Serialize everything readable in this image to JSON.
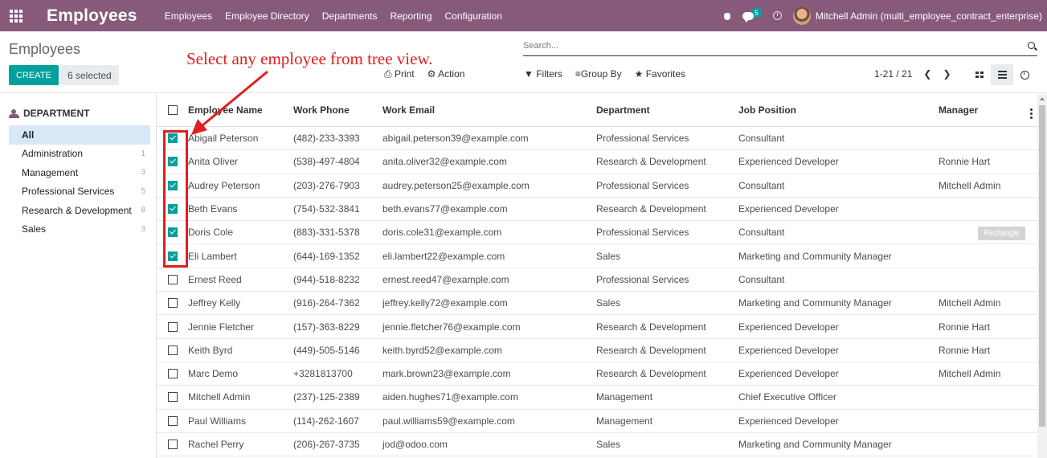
{
  "navbar": {
    "app_title": "Employees",
    "menu": [
      "Employees",
      "Employee Directory",
      "Departments",
      "Reporting",
      "Configuration"
    ],
    "chat_badge": "5",
    "user": "Mitchell Admin (multi_employee_contract_enterprise)"
  },
  "control_panel": {
    "breadcrumb": "Employees",
    "create_label": "CREATE",
    "selected_label": "6 selected",
    "search_placeholder": "Search...",
    "print_label": "Print",
    "action_label": "Action",
    "filters_label": "Filters",
    "group_by_label": "Group By",
    "favorites_label": "Favorites",
    "pager": "1-21 / 21"
  },
  "annotation": "Select any employee from tree view.",
  "sidebar": {
    "title": "DEPARTMENT",
    "items": [
      {
        "label": "All",
        "count": ""
      },
      {
        "label": "Administration",
        "count": "1"
      },
      {
        "label": "Management",
        "count": "3"
      },
      {
        "label": "Professional Services",
        "count": "5"
      },
      {
        "label": "Research & Development",
        "count": "8"
      },
      {
        "label": "Sales",
        "count": "3"
      }
    ]
  },
  "table": {
    "columns": [
      "Employee Name",
      "Work Phone",
      "Work Email",
      "Department",
      "Job Position",
      "Manager"
    ],
    "rows": [
      {
        "name": "Abigail Peterson",
        "phone": "(482)-233-3393",
        "email": "abigail.peterson39@example.com",
        "dept": "Professional Services",
        "job": "Consultant",
        "manager": "",
        "checked": true
      },
      {
        "name": "Anita Oliver",
        "phone": "(538)-497-4804",
        "email": "anita.oliver32@example.com",
        "dept": "Research & Development",
        "job": "Experienced Developer",
        "manager": "Ronnie Hart",
        "checked": true
      },
      {
        "name": "Audrey Peterson",
        "phone": "(203)-276-7903",
        "email": "audrey.peterson25@example.com",
        "dept": "Professional Services",
        "job": "Consultant",
        "manager": "Mitchell Admin",
        "checked": true
      },
      {
        "name": "Beth Evans",
        "phone": "(754)-532-3841",
        "email": "beth.evans77@example.com",
        "dept": "Research & Development",
        "job": "Experienced Developer",
        "manager": "",
        "checked": true
      },
      {
        "name": "Doris Cole",
        "phone": "(883)-331-5378",
        "email": "doris.cole31@example.com",
        "dept": "Professional Services",
        "job": "Consultant",
        "manager": "",
        "checked": true,
        "ghost": "Rectangle"
      },
      {
        "name": "Eli Lambert",
        "phone": "(644)-169-1352",
        "email": "eli.lambert22@example.com",
        "dept": "Sales",
        "job": "Marketing and Community Manager",
        "manager": "",
        "checked": true
      },
      {
        "name": "Ernest Reed",
        "phone": "(944)-518-8232",
        "email": "ernest.reed47@example.com",
        "dept": "Professional Services",
        "job": "Consultant",
        "manager": "",
        "checked": false
      },
      {
        "name": "Jeffrey Kelly",
        "phone": "(916)-264-7362",
        "email": "jeffrey.kelly72@example.com",
        "dept": "Sales",
        "job": "Marketing and Community Manager",
        "manager": "Mitchell Admin",
        "checked": false
      },
      {
        "name": "Jennie Fletcher",
        "phone": "(157)-363-8229",
        "email": "jennie.fletcher76@example.com",
        "dept": "Research & Development",
        "job": "Experienced Developer",
        "manager": "Ronnie Hart",
        "checked": false
      },
      {
        "name": "Keith Byrd",
        "phone": "(449)-505-5146",
        "email": "keith.byrd52@example.com",
        "dept": "Research & Development",
        "job": "Experienced Developer",
        "manager": "Ronnie Hart",
        "checked": false
      },
      {
        "name": "Marc Demo",
        "phone": "+3281813700",
        "email": "mark.brown23@example.com",
        "dept": "Research & Development",
        "job": "Experienced Developer",
        "manager": "Mitchell Admin",
        "checked": false
      },
      {
        "name": "Mitchell Admin",
        "phone": "(237)-125-2389",
        "email": "aiden.hughes71@example.com",
        "dept": "Management",
        "job": "Chief Executive Officer",
        "manager": "",
        "checked": false
      },
      {
        "name": "Paul Williams",
        "phone": "(114)-262-1607",
        "email": "paul.williams59@example.com",
        "dept": "Management",
        "job": "Experienced Developer",
        "manager": "",
        "checked": false
      },
      {
        "name": "Rachel Perry",
        "phone": "(206)-267-3735",
        "email": "jod@odoo.com",
        "dept": "Sales",
        "job": "Marketing and Community Manager",
        "manager": "",
        "checked": false
      }
    ]
  }
}
